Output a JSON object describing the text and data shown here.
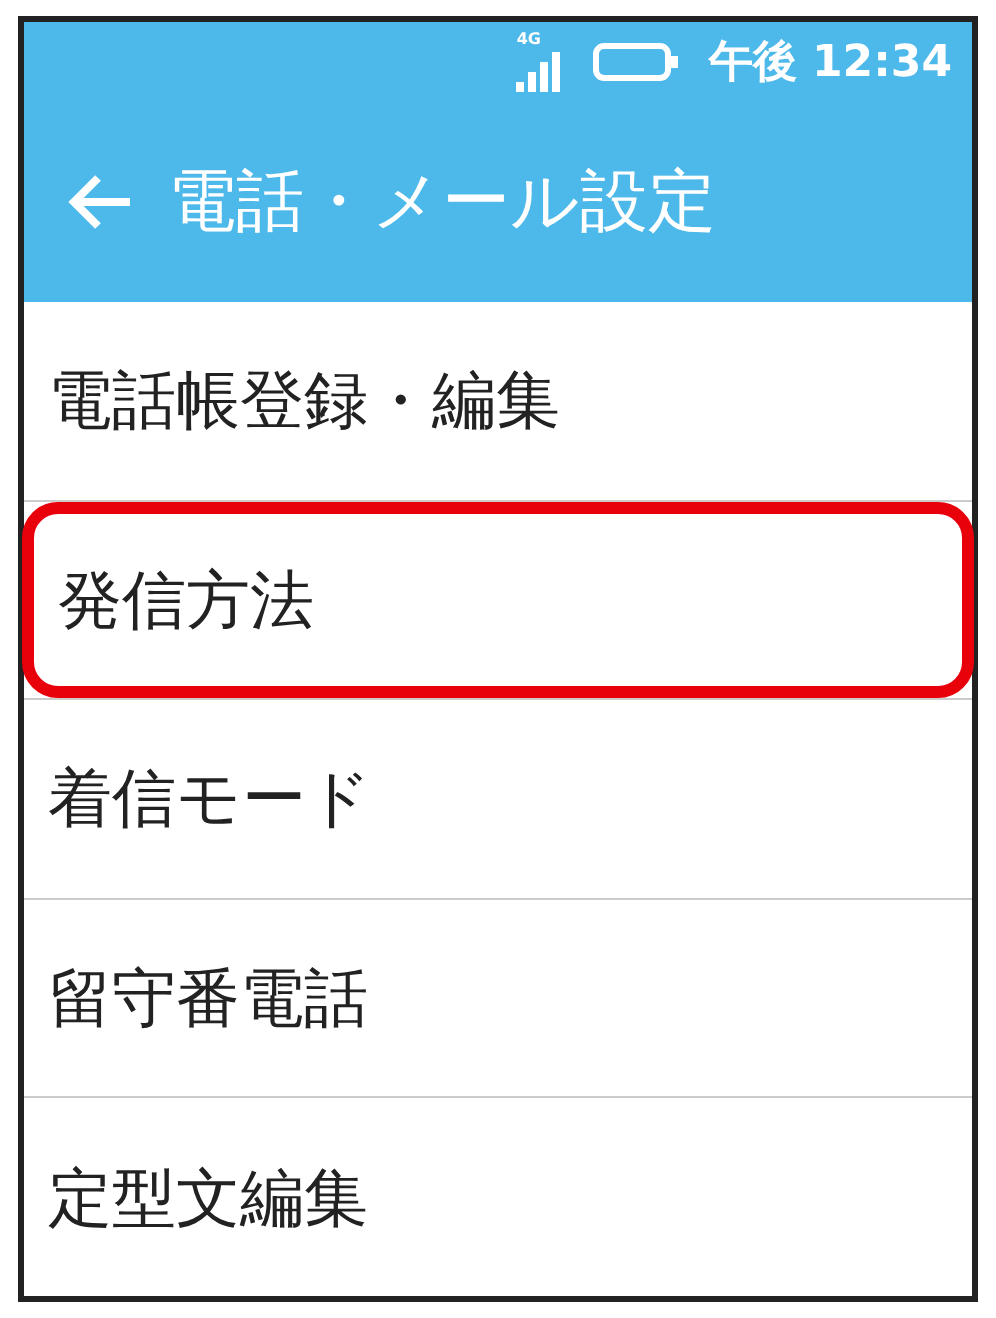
{
  "status_bar": {
    "network": "4G",
    "time": "午後 12:34"
  },
  "header": {
    "title": "電話・メール設定"
  },
  "items": [
    {
      "label": "電話帳登録・編集",
      "selected": false
    },
    {
      "label": "発信方法",
      "selected": true
    },
    {
      "label": "着信モード",
      "selected": false
    },
    {
      "label": "留守番電話",
      "selected": false
    },
    {
      "label": "定型文編集",
      "selected": false
    }
  ]
}
